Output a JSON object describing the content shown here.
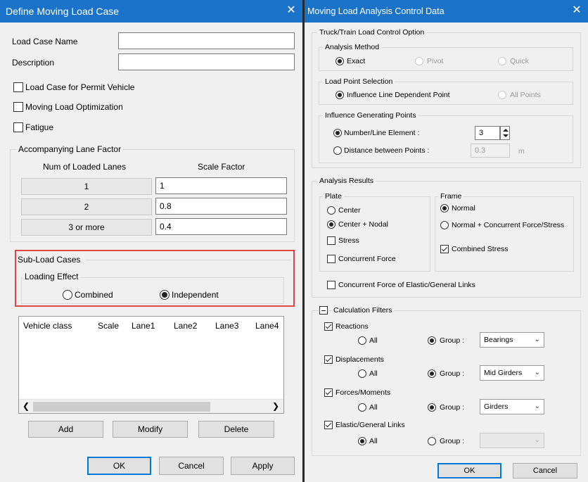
{
  "left": {
    "title": "Define Moving Load Case",
    "close": "✕",
    "load_case_name_label": "Load Case Name",
    "load_case_name_value": "",
    "description_label": "Description",
    "description_value": "",
    "permit_vehicle_label": "Load Case for Permit Vehicle",
    "optimization_label": "Moving Load Optimization",
    "fatigue_label": "Fatigue",
    "lane_factor": {
      "title": "Accompanying Lane Factor",
      "col_lanes": "Num of Loaded Lanes",
      "col_scale": "Scale Factor",
      "rows": [
        {
          "lanes": "1",
          "scale": "1"
        },
        {
          "lanes": "2",
          "scale": "0.8"
        },
        {
          "lanes": "3 or more",
          "scale": "0.4"
        }
      ]
    },
    "sub_load": {
      "title": "Sub-Load Cases",
      "effect_title": "Loading Effect",
      "combined": "Combined",
      "independent": "Independent",
      "selected": "independent"
    },
    "table_headers": [
      "Vehicle class",
      "Scale",
      "Lane1",
      "Lane2",
      "Lane3",
      "Lane4"
    ],
    "buttons": {
      "add": "Add",
      "modify": "Modify",
      "delete": "Delete",
      "ok": "OK",
      "cancel": "Cancel",
      "apply": "Apply"
    }
  },
  "right": {
    "title": "Moving Load Analysis Control Data",
    "close": "✕",
    "truck": {
      "title": "Truck/Train Load Control Option",
      "method_title": "Analysis Method",
      "exact": "Exact",
      "pivot": "Pivot",
      "quick": "Quick",
      "point_title": "Load Point Selection",
      "influence_dependent": "Influence Line Dependent Point",
      "all_points": "All Points",
      "generating_title": "Influence Generating Points",
      "number_line": "Number/Line Element :",
      "number_value": "3",
      "distance": "Distance between Points :",
      "distance_value": "0.3",
      "distance_unit": "m"
    },
    "results": {
      "title": "Analysis Results",
      "plate_title": "Plate",
      "center": "Center",
      "center_nodal": "Center + Nodal",
      "stress": "Stress",
      "concurrent_force": "Concurrent Force",
      "frame_title": "Frame",
      "normal": "Normal",
      "normal_concurrent": "Normal + Concurrent Force/Stress",
      "combined_stress": "Combined Stress",
      "elastic_links": "Concurrent Force of Elastic/General Links"
    },
    "filters": {
      "title": "Calculation Filters",
      "all": "All",
      "group": "Group :",
      "reactions": "Reactions",
      "reactions_group": "Bearings",
      "displacements": "Displacements",
      "displacements_group": "Mid Girders",
      "forces": "Forces/Moments",
      "forces_group": "Girders",
      "elastic": "Elastic/General Links",
      "elastic_group": ""
    },
    "buttons": {
      "ok": "OK",
      "cancel": "Cancel"
    }
  },
  "colors": {
    "titlebar": "#1a73c8",
    "highlight": "#e04444",
    "dialog_bg": "#f0f0f0"
  }
}
